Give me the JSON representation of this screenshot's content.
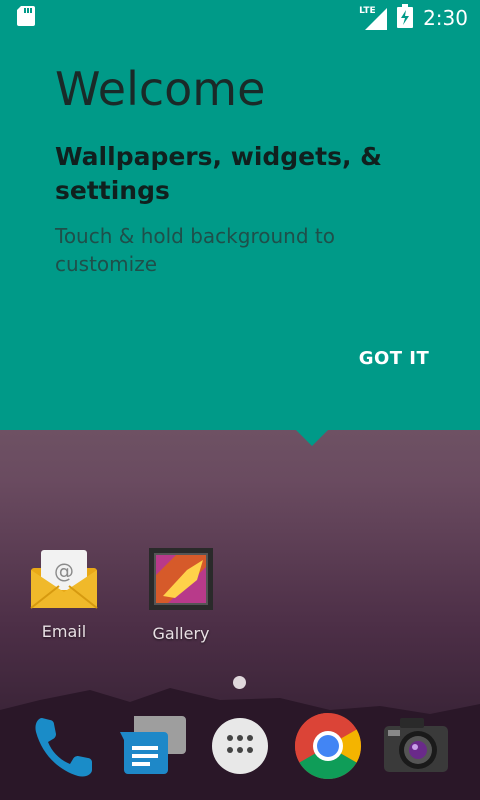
{
  "status_bar": {
    "time": "2:30",
    "network_label": "LTE",
    "icons": [
      "sd-card-icon",
      "signal-icon",
      "battery-charging-icon"
    ]
  },
  "welcome": {
    "title": "Welcome",
    "heading": "Wallpapers, widgets, & settings",
    "body": "Touch & hold background to customize",
    "button_label": "GOT IT",
    "card_color": "#009a88"
  },
  "desktop": {
    "apps": [
      {
        "label": "Email",
        "icon": "email-icon"
      },
      {
        "label": "Gallery",
        "icon": "gallery-icon"
      }
    ],
    "page_indicator": "1 page"
  },
  "dock": {
    "apps": [
      "phone-icon",
      "messaging-icon",
      "app-drawer-icon",
      "chrome-icon",
      "camera-icon"
    ]
  }
}
